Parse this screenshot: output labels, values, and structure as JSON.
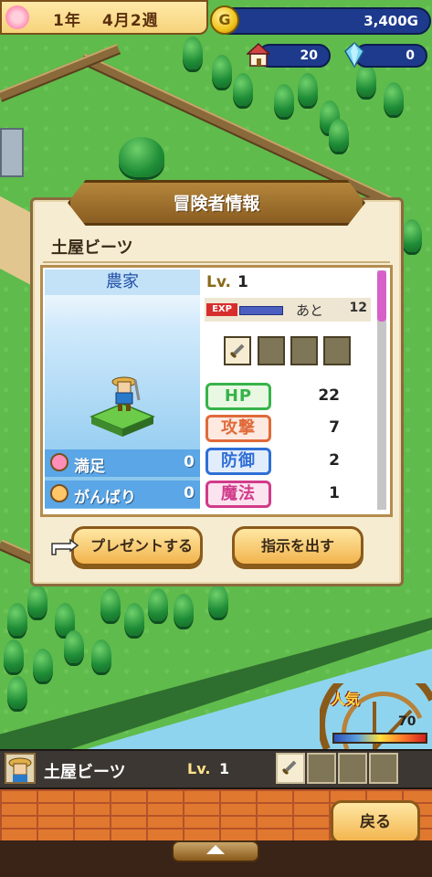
{
  "hud": {
    "year": "1年",
    "month_week": "4月2週",
    "money": "3,400G",
    "coin_symbol": "G",
    "population": "20",
    "crystals": "0"
  },
  "dialog": {
    "title": "冒険者情報",
    "adventurer_name": "土屋ビーツ",
    "job": "農家",
    "level_label": "Lv.",
    "level": "1",
    "exp_tag": "EXP",
    "exp_label": "あと",
    "exp_remaining": "12",
    "mood": [
      {
        "label": "満足",
        "value": "0",
        "icon": "heart-icon"
      },
      {
        "label": "がんばり",
        "value": "0",
        "icon": "fist-icon"
      }
    ],
    "stats": [
      {
        "label": "HP",
        "value": "22",
        "color": "#37b34a"
      },
      {
        "label": "攻撃",
        "value": "7",
        "color": "#e06a3a"
      },
      {
        "label": "防御",
        "value": "2",
        "color": "#2f6fd6"
      },
      {
        "label": "魔法",
        "value": "1",
        "color": "#d23b8a"
      }
    ],
    "buttons": {
      "present": "プレゼントする",
      "instruct": "指示を出す"
    }
  },
  "fame": {
    "label": "人気",
    "value": "70",
    "level_fraction": 0.7
  },
  "bottom_bar": {
    "name": "土屋ビーツ",
    "level_label": "Lv.",
    "level": "1"
  },
  "back_button": "戻る"
}
